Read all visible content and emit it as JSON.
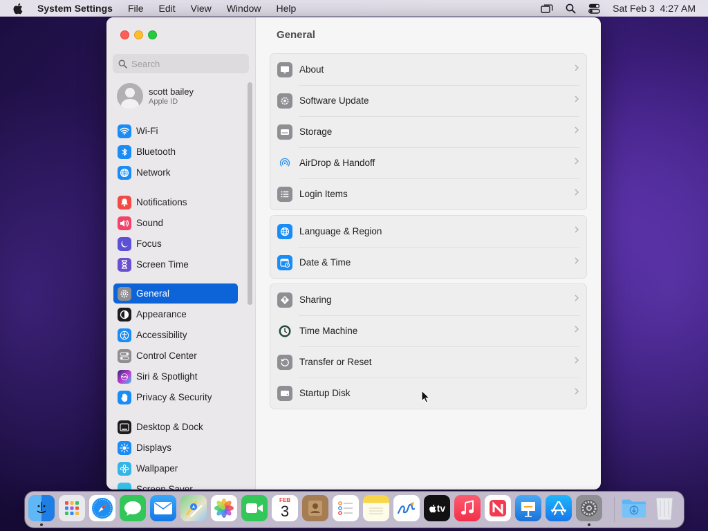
{
  "menubar": {
    "app_name": "System Settings",
    "items": [
      "File",
      "Edit",
      "View",
      "Window",
      "Help"
    ],
    "clock": "Sat Feb 3  4:27 AM"
  },
  "window": {
    "title": "General"
  },
  "sidebar": {
    "search_placeholder": "Search",
    "account": {
      "name": "scott bailey",
      "subtitle": "Apple ID"
    },
    "items": [
      {
        "label": "Wi-Fi",
        "icon": "wifi-icon",
        "color": "#1a8cf5"
      },
      {
        "label": "Bluetooth",
        "icon": "bluetooth-icon",
        "color": "#1a8cf5"
      },
      {
        "label": "Network",
        "icon": "globe-icon",
        "color": "#1a8cf5"
      },
      {
        "label": "Notifications",
        "icon": "bell-icon",
        "color": "#f24a45"
      },
      {
        "label": "Sound",
        "icon": "speaker-icon",
        "color": "#f2446b"
      },
      {
        "label": "Focus",
        "icon": "moon-icon",
        "color": "#5d4fd6"
      },
      {
        "label": "Screen Time",
        "icon": "hourglass-icon",
        "color": "#6a4fd1"
      },
      {
        "label": "General",
        "icon": "gear-icon",
        "color": "#8e8e93",
        "active": true
      },
      {
        "label": "Appearance",
        "icon": "appearance-icon",
        "color": "#1c1c1e"
      },
      {
        "label": "Accessibility",
        "icon": "accessibility-icon",
        "color": "#1a8cf5"
      },
      {
        "label": "Control Center",
        "icon": "toggles-icon",
        "color": "#8e8e93"
      },
      {
        "label": "Siri & Spotlight",
        "icon": "siri-icon",
        "color": "#8c3fd9"
      },
      {
        "label": "Privacy & Security",
        "icon": "hand-icon",
        "color": "#1a8cf5"
      },
      {
        "label": "Desktop & Dock",
        "icon": "dock-icon",
        "color": "#1c1c1e"
      },
      {
        "label": "Displays",
        "icon": "sun-icon",
        "color": "#1a8cf5"
      },
      {
        "label": "Wallpaper",
        "icon": "flower-icon",
        "color": "#34b5e8"
      },
      {
        "label": "Screen Saver",
        "icon": "screensaver-icon",
        "color": "#38c0e8"
      }
    ]
  },
  "main": {
    "groups": [
      [
        {
          "label": "About",
          "icon": "display-icon"
        },
        {
          "label": "Software Update",
          "icon": "gear-badge-icon"
        },
        {
          "label": "Storage",
          "icon": "storage-icon"
        },
        {
          "label": "AirDrop & Handoff",
          "icon": "airdrop-icon"
        },
        {
          "label": "Login Items",
          "icon": "list-icon"
        }
      ],
      [
        {
          "label": "Language & Region",
          "icon": "globe-icon"
        },
        {
          "label": "Date & Time",
          "icon": "calendar-clock-icon"
        }
      ],
      [
        {
          "label": "Sharing",
          "icon": "sharing-icon"
        },
        {
          "label": "Time Machine",
          "icon": "time-machine-icon"
        },
        {
          "label": "Transfer or Reset",
          "icon": "reset-icon"
        },
        {
          "label": "Startup Disk",
          "icon": "disk-icon"
        }
      ]
    ]
  },
  "dock": {
    "calendar": {
      "month": "FEB",
      "day": "3"
    },
    "tv_label": "tv",
    "apps": [
      "finder-icon",
      "launchpad-icon",
      "safari-icon",
      "messages-icon",
      "mail-icon",
      "maps-icon",
      "photos-icon",
      "facetime-icon",
      "calendar-icon",
      "contacts-icon",
      "reminders-icon",
      "notes-icon",
      "freeform-icon",
      "apple-tv-icon",
      "music-icon",
      "news-icon",
      "keynote-icon",
      "app-store-icon",
      "system-settings-icon",
      "downloads-folder-icon",
      "trash-icon"
    ]
  }
}
